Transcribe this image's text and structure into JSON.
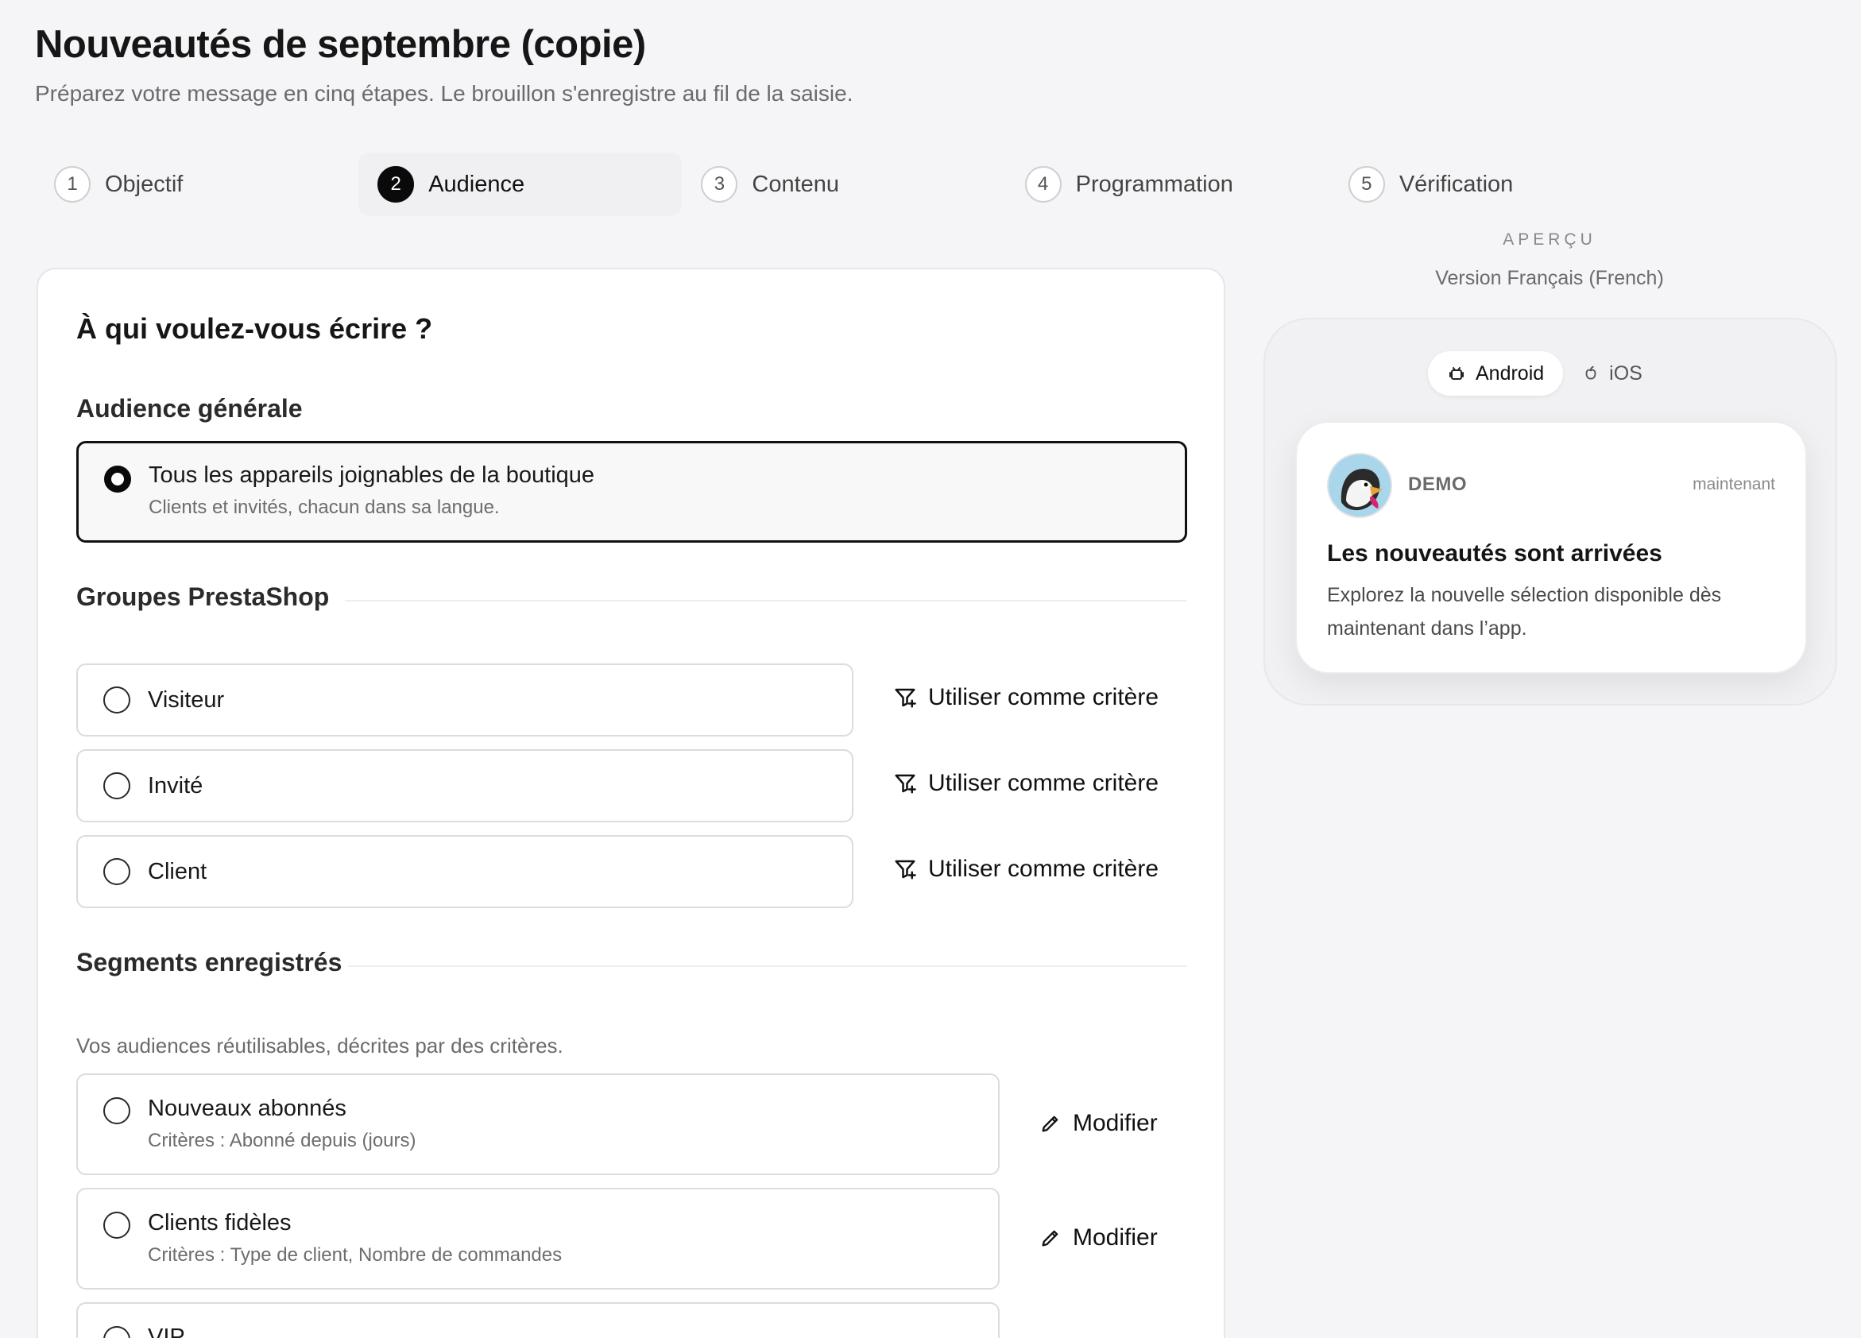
{
  "page": {
    "title": "Nouveautés de septembre (copie)",
    "subtitle": "Préparez votre message en cinq étapes. Le brouillon s'enregistre au fil de la saisie."
  },
  "stepper": {
    "steps": [
      {
        "num": "1",
        "label": "Objectif",
        "active": false
      },
      {
        "num": "2",
        "label": "Audience",
        "active": true
      },
      {
        "num": "3",
        "label": "Contenu",
        "active": false
      },
      {
        "num": "4",
        "label": "Programmation",
        "active": false
      },
      {
        "num": "5",
        "label": "Vérification",
        "active": false
      }
    ]
  },
  "audience": {
    "heading": "À qui voulez-vous écrire ?",
    "general": {
      "title": "Audience générale",
      "option": {
        "label": "Tous les appareils joignables de la boutique",
        "description": "Clients et invités, chacun dans sa langue.",
        "selected": true
      }
    },
    "groups": {
      "title": "Groupes PrestaShop",
      "action_label": "Utiliser comme critère",
      "items": [
        {
          "label": "Visiteur"
        },
        {
          "label": "Invité"
        },
        {
          "label": "Client"
        }
      ]
    },
    "segments": {
      "title": "Segments enregistrés",
      "help": "Vos audiences réutilisables, décrites par des critères.",
      "action_label": "Modifier",
      "items": [
        {
          "label": "Nouveaux abonnés",
          "criteria": "Critères : Abonné depuis (jours)"
        },
        {
          "label": "Clients fidèles",
          "criteria": "Critères : Type de client, Nombre de commandes"
        },
        {
          "label": "VIP"
        }
      ]
    }
  },
  "preview": {
    "eyebrow": "APERÇU",
    "version": "Version Français (French)",
    "platforms": [
      {
        "label": "Android",
        "icon": "android-icon",
        "active": true
      },
      {
        "label": "iOS",
        "icon": "apple-icon",
        "active": false
      }
    ],
    "notification": {
      "app_name": "DEMO",
      "time": "maintenant",
      "title": "Les nouveautés sont arrivées",
      "body": "Explorez la nouvelle sélection disponible dès maintenant dans l’app."
    }
  }
}
